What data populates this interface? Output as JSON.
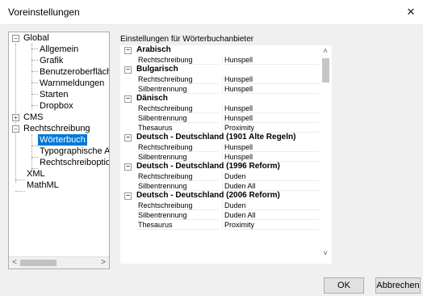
{
  "window": {
    "title": "Voreinstellungen",
    "close_glyph": "✕"
  },
  "tree": {
    "items": [
      {
        "label": "Global"
      },
      {
        "label": "Allgemein"
      },
      {
        "label": "Grafik"
      },
      {
        "label": "Benutzeroberfläch"
      },
      {
        "label": "Warnmeldungen"
      },
      {
        "label": "Starten"
      },
      {
        "label": "Dropbox"
      },
      {
        "label": "CMS"
      },
      {
        "label": "Rechtschreibung"
      },
      {
        "label": "Wörterbuch"
      },
      {
        "label": "Typographische A"
      },
      {
        "label": "Rechtschreiboptio"
      },
      {
        "label": "XML"
      },
      {
        "label": "MathML"
      }
    ],
    "expand_minus": "−",
    "expand_plus": "+",
    "scroll_left": "<",
    "scroll_right": ">"
  },
  "panel": {
    "label": "Einstellungen für Wörterbuchanbieter",
    "groups": [
      {
        "name": "Arabisch",
        "rows": [
          [
            "Rechtschreibung",
            "Hunspell"
          ]
        ]
      },
      {
        "name": "Bulgarisch",
        "rows": [
          [
            "Rechtschreibung",
            "Hunspell"
          ],
          [
            "Silbentrennung",
            "Hunspell"
          ]
        ]
      },
      {
        "name": "Dänisch",
        "rows": [
          [
            "Rechtschreibung",
            "Hunspell"
          ],
          [
            "Silbentrennung",
            "Hunspell"
          ],
          [
            "Thesaurus",
            "Proximity"
          ]
        ]
      },
      {
        "name": "Deutsch - Deutschland (1901 Alte Regeln)",
        "rows": [
          [
            "Rechtschreibung",
            "Hunspell"
          ],
          [
            "Silbentrennung",
            "Hunspell"
          ]
        ]
      },
      {
        "name": "Deutsch - Deutschland (1996 Reform)",
        "rows": [
          [
            "Rechtschreibung",
            "Duden"
          ],
          [
            "Silbentrennung",
            "Duden All"
          ]
        ]
      },
      {
        "name": "Deutsch - Deutschland (2006 Reform)",
        "rows": [
          [
            "Rechtschreibung",
            "Duden"
          ],
          [
            "Silbentrennung",
            "Duden All"
          ],
          [
            "Thesaurus",
            "Proximity"
          ]
        ]
      }
    ],
    "scroll_up": "˄",
    "scroll_down": "˅"
  },
  "buttons": {
    "ok": "OK",
    "cancel": "Abbrechen"
  },
  "colors": {
    "selection": "#0078d7"
  }
}
